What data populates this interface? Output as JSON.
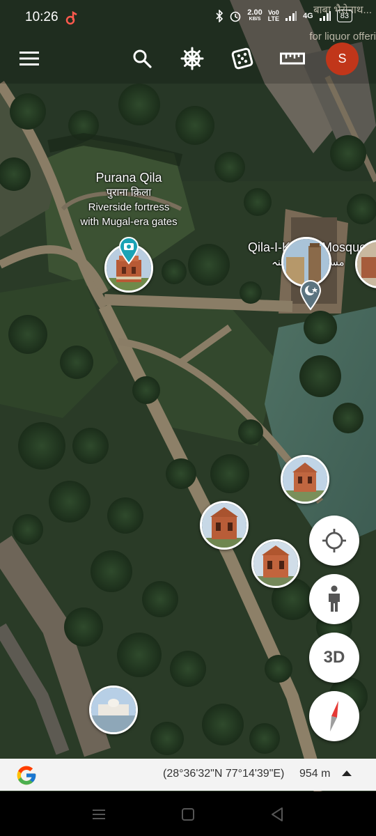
{
  "status_bar": {
    "time": "10:26",
    "network_speed_value": "2.00",
    "network_speed_unit": "KB/S",
    "volte_top": "Vo0",
    "volte_bottom": "LTE",
    "network_type": "4G",
    "battery": "83"
  },
  "toolbar": {
    "menu_icon": "hamburger-menu-icon",
    "search_icon": "search-icon",
    "voyager_icon": "ships-wheel-icon",
    "feeling_lucky_icon": "dice-icon",
    "measure_icon": "ruler-icon",
    "avatar_initial": "S"
  },
  "background_labels": {
    "top_right_line1": "बाबा भैरोनाथ...",
    "top_right_line2": "for liquor offeri"
  },
  "places": {
    "purana_qila": {
      "name": "Purana Qila",
      "local_name": "पुराना क़िला",
      "description_line1": "Riverside fortress",
      "description_line2": "with Mugal-era gates"
    },
    "qila_i_kuhna": {
      "name": "Qila-I-Kuhna Mosque",
      "local_name": "مسجد قلعہ کہنہ"
    }
  },
  "map_controls": {
    "my_location_icon": "crosshair-location-icon",
    "street_view_icon": "pegman-icon",
    "toggle_3d_label": "3D",
    "compass_icon": "compass-icon"
  },
  "info_bar": {
    "logo_icon": "google-g-icon",
    "coordinates": "(28°36'32\"N 77°14'39\"E)",
    "scale": "954 m",
    "expand_icon": "triangle-up-icon"
  },
  "nav_bar": {
    "recents_icon": "recents-icon",
    "home_icon": "home-icon",
    "back_icon": "back-icon"
  },
  "colors": {
    "avatar": "#c1361a",
    "marker_teal": "#1aa3b5",
    "compass_red": "#e53935"
  }
}
